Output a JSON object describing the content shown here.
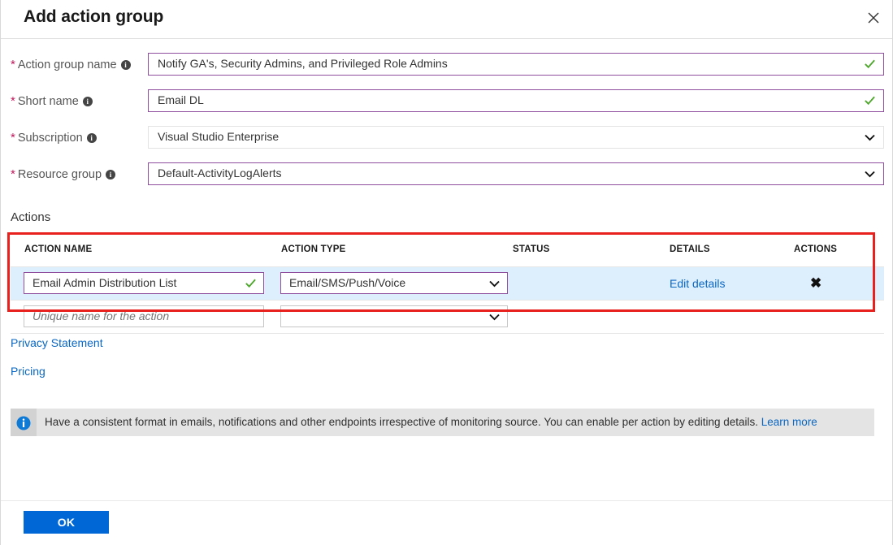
{
  "header": {
    "title": "Add action group",
    "close_icon": "close-icon"
  },
  "form": {
    "fields": [
      {
        "label": "Action group name",
        "required": true,
        "info_icon": "info-icon",
        "value": "Notify GA's, Security Admins, and Privileged Role Admins",
        "state": "valid",
        "trailing_icon": "checkmark-icon",
        "control": "text"
      },
      {
        "label": "Short name",
        "required": true,
        "info_icon": "info-icon",
        "value": "Email DL",
        "state": "valid",
        "trailing_icon": "checkmark-icon",
        "control": "text"
      },
      {
        "label": "Subscription",
        "required": true,
        "info_icon": "info-icon",
        "value": "Visual Studio Enterprise",
        "state": "plain",
        "trailing_icon": "chevron-down-icon",
        "control": "select"
      },
      {
        "label": "Resource group",
        "required": true,
        "info_icon": "info-icon",
        "value": "Default-ActivityLogAlerts",
        "state": "valid",
        "trailing_icon": "chevron-down-icon",
        "control": "select"
      }
    ]
  },
  "actions_section": {
    "heading": "Actions",
    "columns": [
      "ACTION NAME",
      "ACTION TYPE",
      "STATUS",
      "DETAILS",
      "ACTIONS"
    ],
    "rows": [
      {
        "selected": true,
        "action_name": "Email Admin Distribution List",
        "action_name_placeholder": "Unique name for the action",
        "action_type": "Email/SMS/Push/Voice",
        "status": "",
        "details_link": "Edit details",
        "remove_label": "✖"
      },
      {
        "selected": false,
        "action_name": "",
        "action_name_placeholder": "Unique name for the action",
        "action_type": "",
        "status": "",
        "details_link": "",
        "remove_label": ""
      }
    ]
  },
  "links": {
    "privacy": "Privacy Statement",
    "pricing": "Pricing"
  },
  "info_banner": {
    "icon": "info-circle-icon",
    "text": "Have a consistent format in emails, notifications and other endpoints irrespective of monitoring source. You can enable per action by editing details.",
    "link_text": "Learn more"
  },
  "footer": {
    "ok_label": "OK"
  },
  "colors": {
    "accent_purple": "#8f4f9e",
    "link_blue": "#0a67c2",
    "primary_button": "#0068d6",
    "valid_green": "#4fa72e",
    "required_red": "#c2185b",
    "highlight_red": "#e8201e",
    "selected_row": "#ddeefc",
    "banner_grey": "#e4e4e4"
  }
}
